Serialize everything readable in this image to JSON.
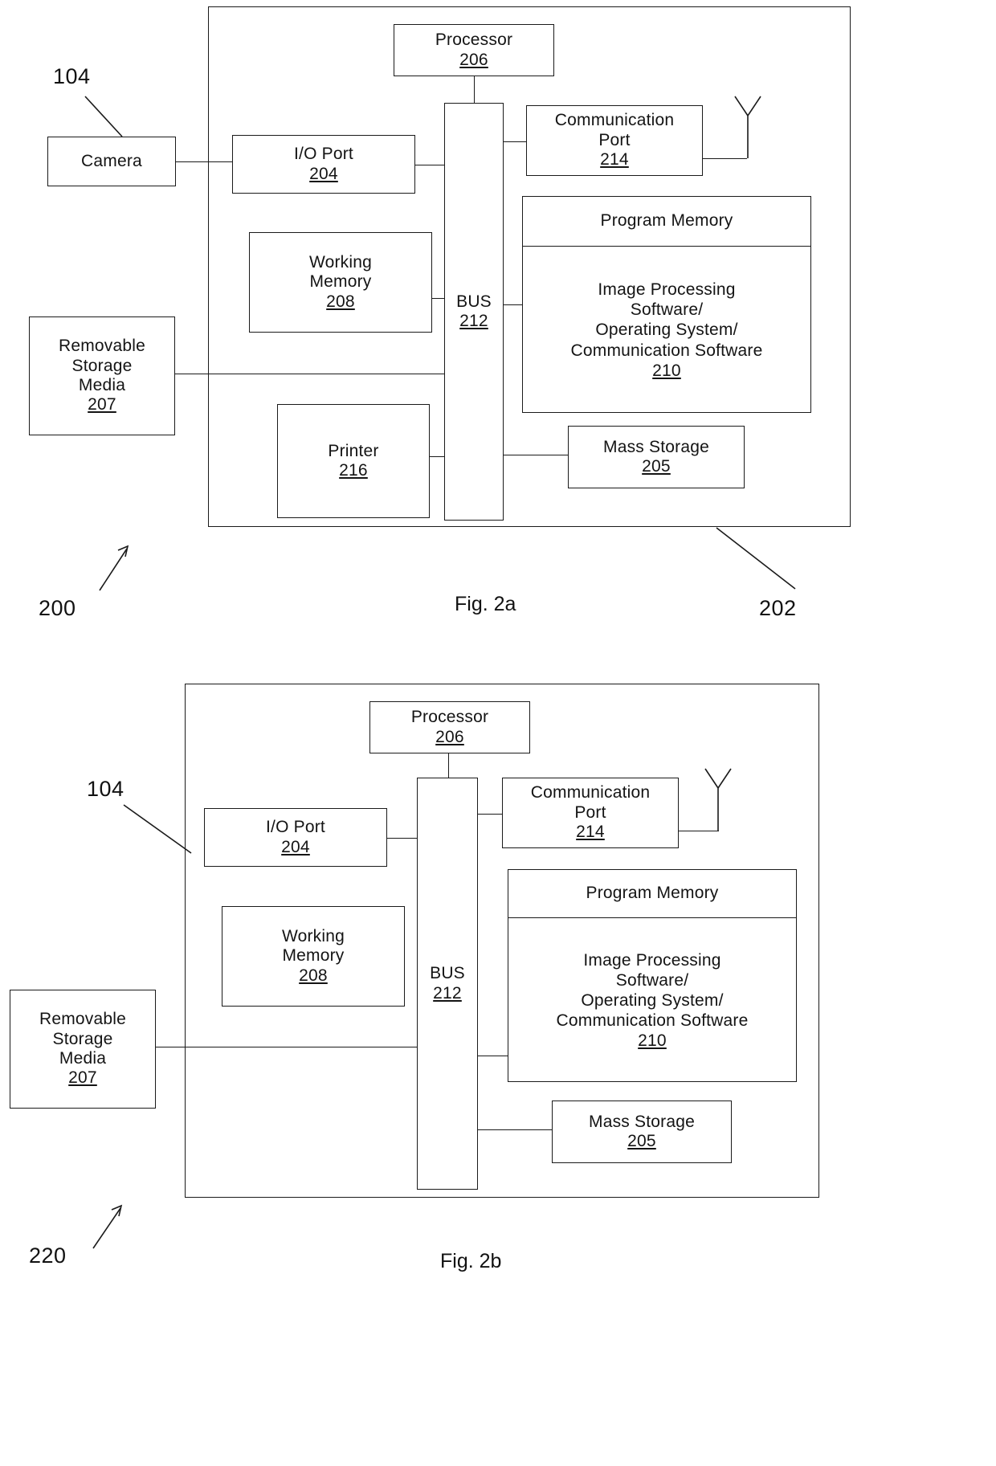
{
  "page": {
    "kind": "patent-figure-sheet",
    "figures": [
      {
        "id": "fig2a",
        "caption": "Fig. 2a",
        "system_ref": "200",
        "device_ref": "104",
        "chassis_ref": "202",
        "blocks": {
          "camera": {
            "label": "Camera",
            "num": ""
          },
          "io_port": {
            "label": "I/O Port",
            "num": "204"
          },
          "processor": {
            "label": "Processor",
            "num": "206"
          },
          "bus": {
            "label": "BUS",
            "num": "212"
          },
          "communication_port": {
            "label_line1": "Communication",
            "label_line2": "Port",
            "num": "214"
          },
          "working_memory": {
            "label_line1": "Working",
            "label_line2": "Memory",
            "num": "208"
          },
          "removable_storage": {
            "label_line1": "Removable",
            "label_line2": "Storage",
            "label_line3": "Media",
            "num": "207"
          },
          "printer": {
            "label": "Printer",
            "num": "216"
          },
          "mass_storage": {
            "label": "Mass Storage",
            "num": "205"
          },
          "program_memory": {
            "title": "Program Memory",
            "body_line1": "Image Processing",
            "body_line2": "Software/",
            "body_line3": "Operating System/",
            "body_line4": "Communication Software",
            "num": "210"
          }
        }
      },
      {
        "id": "fig2b",
        "caption": "Fig. 2b",
        "system_ref": "220",
        "device_ref": "104",
        "blocks": {
          "io_port": {
            "label": "I/O Port",
            "num": "204"
          },
          "processor": {
            "label": "Processor",
            "num": "206"
          },
          "bus": {
            "label": "BUS",
            "num": "212"
          },
          "communication_port": {
            "label_line1": "Communication",
            "label_line2": "Port",
            "num": "214"
          },
          "working_memory": {
            "label_line1": "Working",
            "label_line2": "Memory",
            "num": "208"
          },
          "removable_storage": {
            "label_line1": "Removable",
            "label_line2": "Storage",
            "label_line3": "Media",
            "num": "207"
          },
          "mass_storage": {
            "label": "Mass Storage",
            "num": "205"
          },
          "program_memory": {
            "title": "Program Memory",
            "body_line1": "Image Processing",
            "body_line2": "Software/",
            "body_line3": "Operating System/",
            "body_line4": "Communication Software",
            "num": "210"
          }
        }
      }
    ],
    "colors": {
      "ink": "#1a1a1a",
      "paper": "#ffffff"
    }
  }
}
